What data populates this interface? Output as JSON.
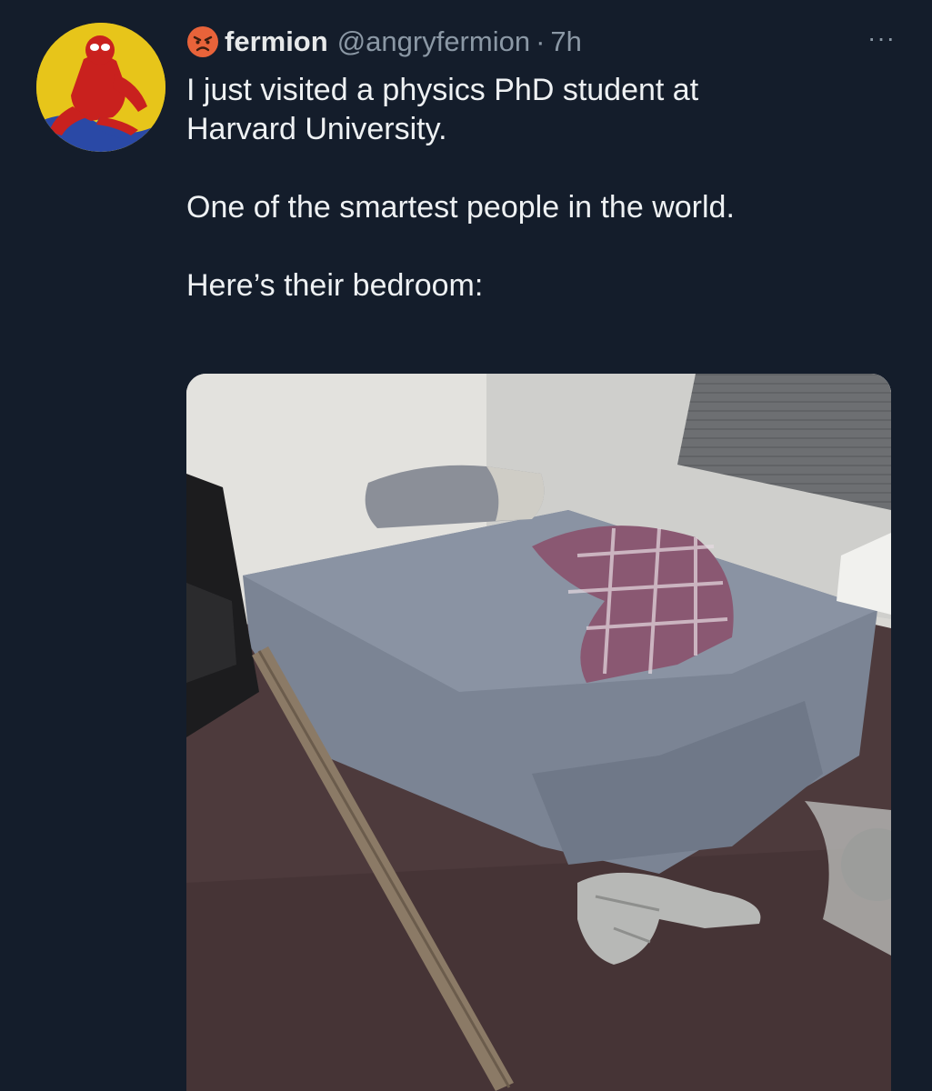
{
  "tweet": {
    "display_name": "fermion",
    "handle": "@angryfermion",
    "separator": "·",
    "time": "7h",
    "more": "···",
    "text_line1": "I just visited a physics PhD student at",
    "text_line2": "Harvard University.",
    "text_line3": "One of the smartest people in the world.",
    "text_line4": "Here’s their bedroom:"
  },
  "icons": {
    "avatar": "spider-man-avatar",
    "emoji": "angry-face-emoji",
    "more": "more-options-icon"
  },
  "colors": {
    "background": "#141d2b",
    "text": "#e7e9ea",
    "muted": "#8b98a5"
  }
}
